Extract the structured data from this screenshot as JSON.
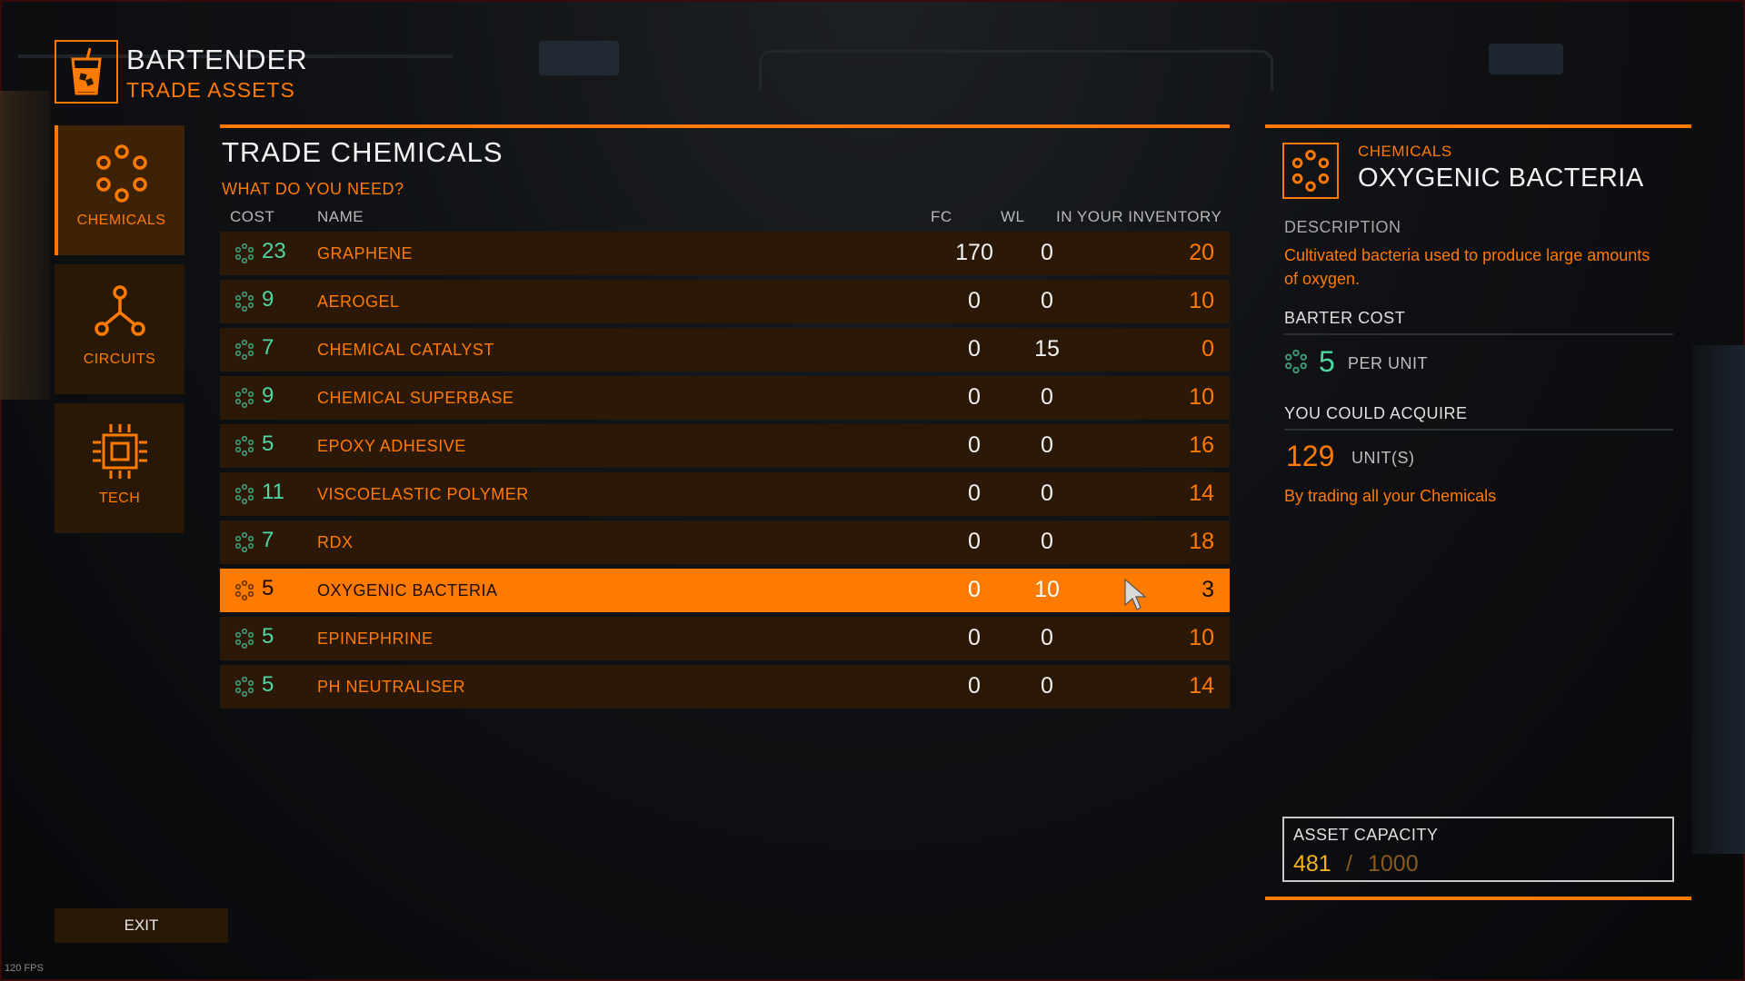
{
  "header": {
    "title": "BARTENDER",
    "subtitle": "TRADE ASSETS"
  },
  "nav": [
    {
      "label": "CHEMICALS",
      "icon": "chemicals-icon",
      "active": true
    },
    {
      "label": "CIRCUITS",
      "icon": "circuits-icon",
      "active": false
    },
    {
      "label": "TECH",
      "icon": "tech-chip-icon",
      "active": false
    }
  ],
  "exit_label": "EXIT",
  "fps": "120 FPS",
  "main": {
    "title": "TRADE CHEMICALS",
    "subtitle": "WHAT DO YOU NEED?",
    "columns": {
      "cost": "COST",
      "name": "NAME",
      "fc": "FC",
      "wl": "WL",
      "inventory": "IN YOUR INVENTORY"
    },
    "rows": [
      {
        "cost": "23",
        "name": "GRAPHENE",
        "fc": "170",
        "wl": "0",
        "inv": "20"
      },
      {
        "cost": "9",
        "name": "AEROGEL",
        "fc": "0",
        "wl": "0",
        "inv": "10"
      },
      {
        "cost": "7",
        "name": "CHEMICAL CATALYST",
        "fc": "0",
        "wl": "15",
        "inv": "0"
      },
      {
        "cost": "9",
        "name": "CHEMICAL SUPERBASE",
        "fc": "0",
        "wl": "0",
        "inv": "10"
      },
      {
        "cost": "5",
        "name": "EPOXY ADHESIVE",
        "fc": "0",
        "wl": "0",
        "inv": "16"
      },
      {
        "cost": "11",
        "name": "VISCOELASTIC POLYMER",
        "fc": "0",
        "wl": "0",
        "inv": "14"
      },
      {
        "cost": "7",
        "name": "RDX",
        "fc": "0",
        "wl": "0",
        "inv": "18"
      },
      {
        "cost": "5",
        "name": "OXYGENIC BACTERIA",
        "fc": "0",
        "wl": "10",
        "inv": "3",
        "selected": true
      },
      {
        "cost": "5",
        "name": "EPINEPHRINE",
        "fc": "0",
        "wl": "0",
        "inv": "10"
      },
      {
        "cost": "5",
        "name": "PH NEUTRALISER",
        "fc": "0",
        "wl": "0",
        "inv": "14"
      }
    ]
  },
  "detail": {
    "category": "CHEMICALS",
    "name": "OXYGENIC BACTERIA",
    "description_label": "DESCRIPTION",
    "description": "Cultivated bacteria used to produce large amounts of oxygen.",
    "barter_label": "BARTER COST",
    "barter_value": "5",
    "barter_unit": "PER UNIT",
    "acquire_label": "YOU COULD ACQUIRE",
    "acquire_value": "129",
    "acquire_unit": "UNIT(S)",
    "acquire_note": "By trading all your Chemicals"
  },
  "capacity": {
    "label": "ASSET CAPACITY",
    "current": "481",
    "separator": "/",
    "max": "1000"
  },
  "colors": {
    "accent": "#ff7a00",
    "cost_green": "#4dd8a3",
    "row_bg": "#2b1807",
    "capacity_gold": "#f0b020"
  }
}
